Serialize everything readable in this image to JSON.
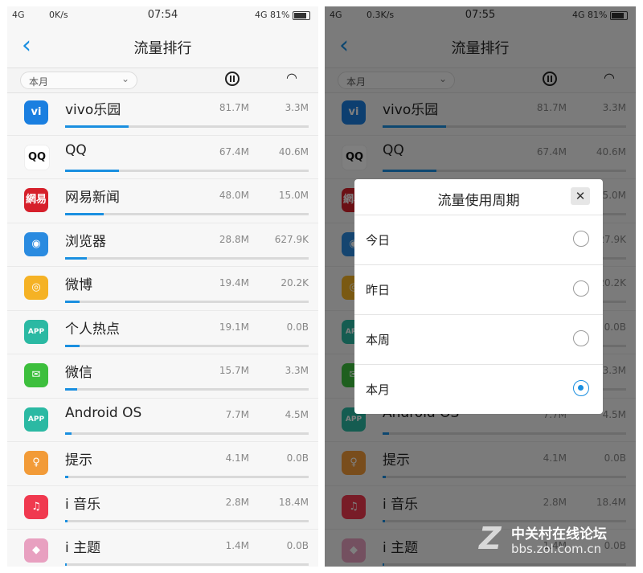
{
  "status_left": {
    "network": "4G",
    "speed": "0K/s",
    "time": "07:54",
    "right": "4G 81%"
  },
  "status_right": {
    "network": "4G",
    "speed": "0.3K/s",
    "time": "07:55",
    "right": "4G 81%"
  },
  "header": {
    "back_icon": "back-chevron-icon",
    "title": "流量排行"
  },
  "filter": {
    "period": "本月",
    "mobile_icon": "mobile-data-icon",
    "wifi_icon": "wifi-icon"
  },
  "apps": [
    {
      "name": "vivo乐园",
      "mobile": "81.7M",
      "wifi": "3.3M",
      "share": 0.26,
      "icon_color": "#1a7fe0",
      "icon_text": "vi"
    },
    {
      "name": "QQ",
      "mobile": "67.4M",
      "wifi": "40.6M",
      "share": 0.22,
      "icon_color": "#ffffff",
      "icon_text": "QQ"
    },
    {
      "name": "网易新闻",
      "mobile": "48.0M",
      "wifi": "15.0M",
      "share": 0.16,
      "icon_color": "#d6202b",
      "icon_text": "網易"
    },
    {
      "name": "浏览器",
      "mobile": "28.8M",
      "wifi": "627.9K",
      "share": 0.09,
      "icon_color": "#2a8be0",
      "icon_text": "◉"
    },
    {
      "name": "微博",
      "mobile": "19.4M",
      "wifi": "20.2K",
      "share": 0.06,
      "icon_color": "#f5b225",
      "icon_text": "◎"
    },
    {
      "name": "个人热点",
      "mobile": "19.1M",
      "wifi": "0.0B",
      "share": 0.06,
      "icon_color": "#2bb9a3",
      "icon_text": "APP"
    },
    {
      "name": "微信",
      "mobile": "15.7M",
      "wifi": "3.3M",
      "share": 0.05,
      "icon_color": "#3dbf3d",
      "icon_text": "✉"
    },
    {
      "name": "Android OS",
      "mobile": "7.7M",
      "wifi": "4.5M",
      "share": 0.025,
      "icon_color": "#2bb9a3",
      "icon_text": "APP"
    },
    {
      "name": "提示",
      "mobile": "4.1M",
      "wifi": "0.0B",
      "share": 0.013,
      "icon_color": "#f29b38",
      "icon_text": "♀"
    },
    {
      "name": "i 音乐",
      "mobile": "2.8M",
      "wifi": "18.4M",
      "share": 0.009,
      "icon_color": "#f0394f",
      "icon_text": "♫"
    },
    {
      "name": "i 主题",
      "mobile": "1.4M",
      "wifi": "0.0B",
      "share": 0.005,
      "icon_color": "#e8a0c0",
      "icon_text": "◆"
    }
  ],
  "dialog": {
    "title": "流量使用周期",
    "close_icon": "close-icon",
    "options": [
      {
        "label": "今日",
        "checked": false
      },
      {
        "label": "昨日",
        "checked": false
      },
      {
        "label": "本周",
        "checked": false
      },
      {
        "label": "本月",
        "checked": true
      }
    ]
  },
  "watermark": {
    "brand": "中关村在线论坛",
    "url": "bbs.zol.com.cn",
    "logo_icon": "zol-logo-icon"
  },
  "colors": {
    "accent": "#1a8fe0",
    "overlay": "rgba(0,0,0,0.5)"
  }
}
